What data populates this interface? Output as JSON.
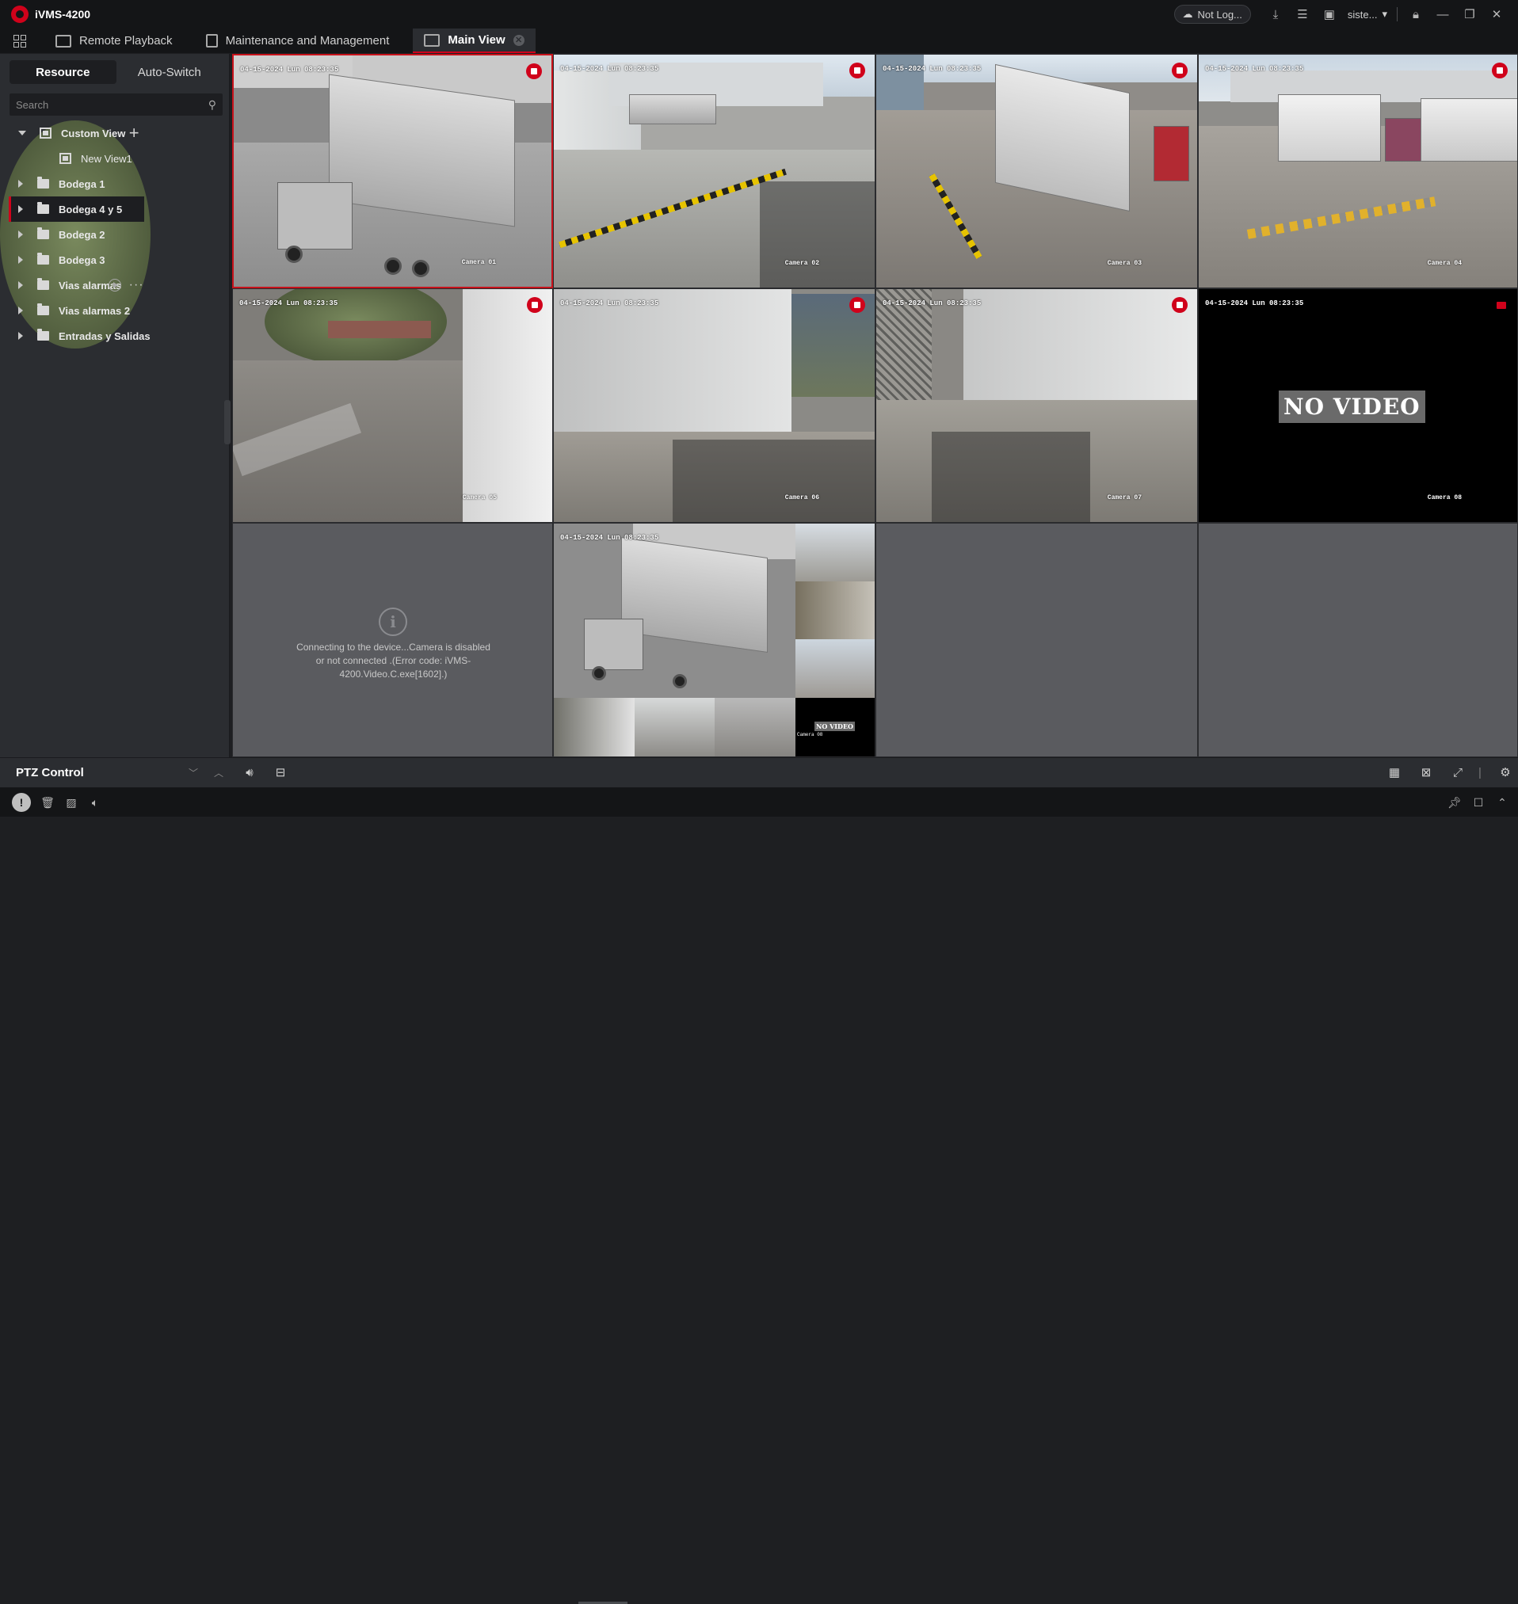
{
  "app": {
    "title": "iVMS-4200"
  },
  "titlebar": {
    "cloud_label": "Not Log...",
    "user_label": "siste...",
    "icons": [
      "cloud-icon",
      "download-icon",
      "task-list-icon",
      "picture-icon",
      "user-dropdown-icon",
      "lock-icon",
      "minimize-icon",
      "restore-icon",
      "close-icon"
    ]
  },
  "tabs": [
    {
      "label": "Remote Playback",
      "icon": "playback-icon"
    },
    {
      "label": "Maintenance and Management",
      "icon": "maintenance-icon"
    },
    {
      "label": "Main View",
      "icon": "main-view-icon",
      "active": true
    }
  ],
  "left_panel": {
    "segments": [
      "Resource",
      "Auto-Switch"
    ],
    "active_segment": "Resource",
    "search_placeholder": "Search",
    "tree": [
      {
        "label": "Custom View",
        "type": "view-group",
        "expanded": true
      },
      {
        "label": "New View1",
        "type": "view",
        "child": true
      },
      {
        "label": "Bodega 1",
        "type": "folder"
      },
      {
        "label": "Bodega 4 y 5",
        "type": "folder",
        "selected": true
      },
      {
        "label": "Bodega 2",
        "type": "folder"
      },
      {
        "label": "Bodega 3",
        "type": "folder"
      },
      {
        "label": "Vias alarmas",
        "type": "folder",
        "hover_tools": true
      },
      {
        "label": "Vias alarmas 2",
        "type": "folder"
      },
      {
        "label": "Entradas y Salidas",
        "type": "folder"
      }
    ]
  },
  "grid": {
    "cells": [
      {
        "time": "04-15-2024 Lun 08:23:35",
        "camera": "Camera 01",
        "recording": true,
        "selected": true
      },
      {
        "time": "04-15-2024 Lun 08:23:35",
        "camera": "Camera 02",
        "recording": true
      },
      {
        "time": "04-15-2024 Lun 08:23:35",
        "camera": "Camera 03",
        "recording": true
      },
      {
        "time": "04-15-2024 Lun 08:23:35",
        "camera": "Camera 04",
        "recording": true
      },
      {
        "time": "04-15-2024 Lun 08:23:35",
        "camera": "Camera 05",
        "recording": true
      },
      {
        "time": "04-15-2024 Lun 08:23:35",
        "camera": "Camera 06",
        "recording": true
      },
      {
        "time": "04-15-2024 Lun 08:23:35",
        "camera": "Camera 07",
        "recording": true
      },
      {
        "time": "04-15-2024 Lun 08:23:35",
        "camera": "Camera 08",
        "recording": true,
        "no_video": "NO VIDEO"
      }
    ],
    "error_message": "Connecting to the device...Camera is disabled or not connected .(Error code: iVMS-4200.Video.C.exe[1602].)",
    "mosaic": {
      "time": "04-15-2024 Lun 08:23:35",
      "camera": "Camera 08",
      "no_video": "NO VIDEO"
    }
  },
  "ptz": {
    "title": "PTZ Control"
  },
  "colors": {
    "accent": "#d0021b",
    "background": "#1e1f22",
    "panel": "#2b2d31",
    "empty_cell": "#5a5b5f"
  }
}
